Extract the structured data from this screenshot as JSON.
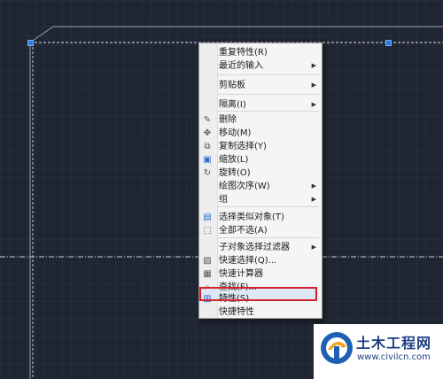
{
  "context_menu": {
    "items": [
      {
        "label": "重复特性(R)",
        "icon": "",
        "submenu": false
      },
      {
        "label": "最近的输入",
        "icon": "",
        "submenu": true
      },
      {
        "label": "剪贴板",
        "icon": "",
        "submenu": true
      },
      {
        "label": "隔离(I)",
        "icon": "",
        "submenu": true
      },
      {
        "label": "删除",
        "icon": "eraser-icon",
        "submenu": false
      },
      {
        "label": "移动(M)",
        "icon": "move-icon",
        "submenu": false
      },
      {
        "label": "复制选择(Y)",
        "icon": "copy-icon",
        "submenu": false
      },
      {
        "label": "缩放(L)",
        "icon": "scale-icon",
        "submenu": false
      },
      {
        "label": "旋转(O)",
        "icon": "rotate-icon",
        "submenu": false
      },
      {
        "label": "绘图次序(W)",
        "icon": "",
        "submenu": true
      },
      {
        "label": "组",
        "icon": "",
        "submenu": true
      },
      {
        "label": "选择类似对象(T)",
        "icon": "select-similar-icon",
        "submenu": false
      },
      {
        "label": "全部不选(A)",
        "icon": "deselect-icon",
        "submenu": false
      },
      {
        "label": "子对象选择过滤器",
        "icon": "",
        "submenu": true
      },
      {
        "label": "快速选择(Q)...",
        "icon": "quick-select-icon",
        "submenu": false
      },
      {
        "label": "快速计算器",
        "icon": "calculator-icon",
        "submenu": false
      },
      {
        "label": "查找(F)...",
        "icon": "find-icon",
        "submenu": false
      },
      {
        "label": "特性(S)",
        "icon": "properties-icon",
        "submenu": false,
        "highlighted": true
      },
      {
        "label": "快捷特性",
        "icon": "",
        "submenu": false
      }
    ]
  },
  "watermark": {
    "title": "土木工程网",
    "url": "www.civilcn.com"
  },
  "colors": {
    "canvas": "#1f2532",
    "highlight_border": "#d3222a",
    "grip": "#2f7dd8",
    "watermark_text": "#1f3f82"
  }
}
